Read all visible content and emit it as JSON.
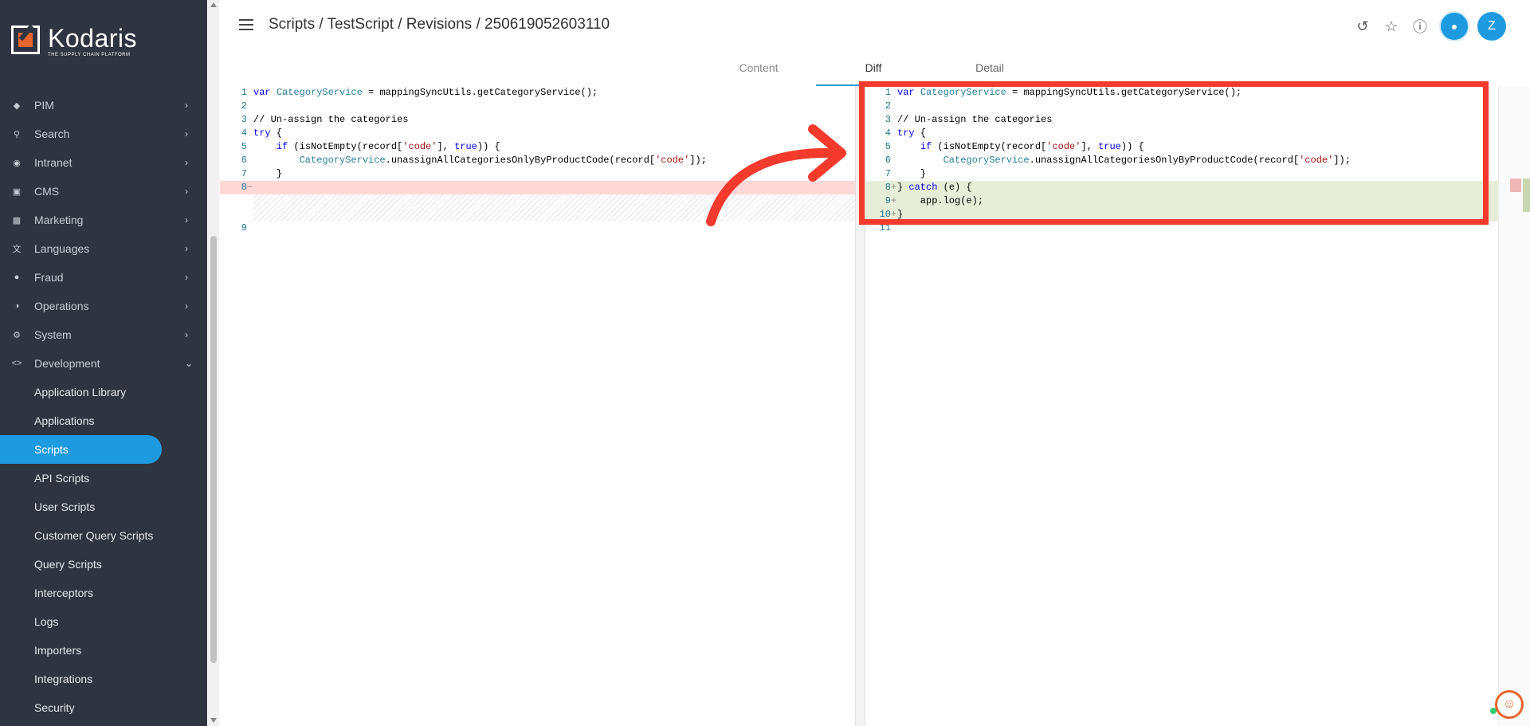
{
  "brand": {
    "name": "Kodaris",
    "tagline": "THE SUPPLY CHAIN PLATFORM",
    "accent": "#1e9be0",
    "logo_color": "#e8662d"
  },
  "sidebar": {
    "items": [
      {
        "label": "PIM",
        "icon": "tag-icon"
      },
      {
        "label": "Search",
        "icon": "search-icon"
      },
      {
        "label": "Intranet",
        "icon": "globe-icon"
      },
      {
        "label": "CMS",
        "icon": "window-icon"
      },
      {
        "label": "Marketing",
        "icon": "card-icon"
      },
      {
        "label": "Languages",
        "icon": "translate-icon"
      },
      {
        "label": "Fraud",
        "icon": "alert-icon"
      },
      {
        "label": "Operations",
        "icon": "palette-icon"
      },
      {
        "label": "System",
        "icon": "gear-icon"
      },
      {
        "label": "Development",
        "icon": "code-icon"
      }
    ],
    "sub_items": [
      "Application Library",
      "Applications",
      "Scripts",
      "API Scripts",
      "User Scripts",
      "Customer Query Scripts",
      "Query Scripts",
      "Interceptors",
      "Logs",
      "Importers",
      "Integrations",
      "Security"
    ],
    "active_sub": "Scripts"
  },
  "header": {
    "breadcrumb": "Scripts / TestScript / Revisions / 250619052603110",
    "avatar_letter": "Z"
  },
  "tabs": [
    "Content",
    "Diff",
    "Detail"
  ],
  "active_tab": "Diff",
  "diff": {
    "left_lines": [
      {
        "n": "1",
        "text": "var CategoryService = mappingSyncUtils.getCategoryService();"
      },
      {
        "n": "2",
        "text": ""
      },
      {
        "n": "3",
        "text": "// Un-assign the categories"
      },
      {
        "n": "4",
        "text": "try {"
      },
      {
        "n": "5",
        "text": "    if (isNotEmpty(record['code'], true)) {"
      },
      {
        "n": "6",
        "text": "        CategoryService.unassignAllCategoriesOnlyByProductCode(record['code']);"
      },
      {
        "n": "7",
        "text": "    }"
      },
      {
        "n": "8",
        "text": "",
        "marker": "−"
      },
      {
        "n": "9",
        "text": ""
      }
    ],
    "right_lines": [
      {
        "n": "1",
        "text": "var CategoryService = mappingSyncUtils.getCategoryService();"
      },
      {
        "n": "2",
        "text": ""
      },
      {
        "n": "3",
        "text": "// Un-assign the categories"
      },
      {
        "n": "4",
        "text": "try {"
      },
      {
        "n": "5",
        "text": "    if (isNotEmpty(record['code'], true)) {"
      },
      {
        "n": "6",
        "text": "        CategoryService.unassignAllCategoriesOnlyByProductCode(record['code']);"
      },
      {
        "n": "7",
        "text": "    }"
      },
      {
        "n": "8",
        "text": "} catch (e) {",
        "marker": "+"
      },
      {
        "n": "9",
        "text": "    app.log(e);",
        "marker": "+"
      },
      {
        "n": "10",
        "text": "}",
        "marker": "+"
      },
      {
        "n": "11",
        "text": ""
      }
    ]
  }
}
